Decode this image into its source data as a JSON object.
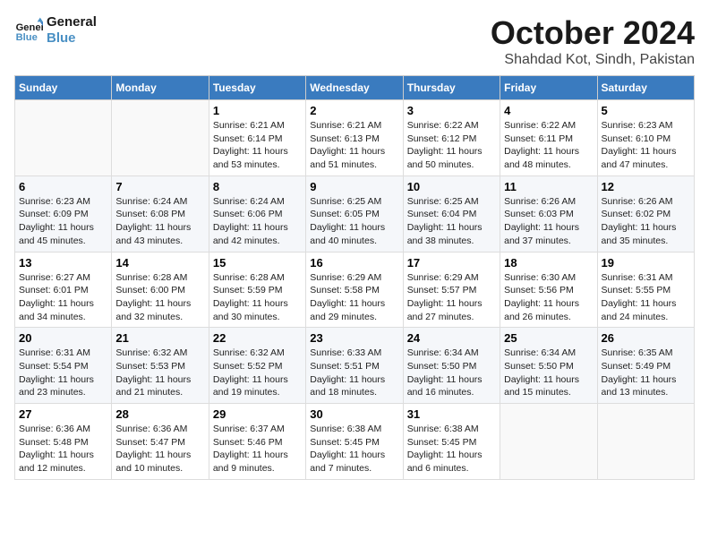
{
  "header": {
    "logo_line1": "General",
    "logo_line2": "Blue",
    "month": "October 2024",
    "location": "Shahdad Kot, Sindh, Pakistan"
  },
  "weekdays": [
    "Sunday",
    "Monday",
    "Tuesday",
    "Wednesday",
    "Thursday",
    "Friday",
    "Saturday"
  ],
  "weeks": [
    [
      {
        "day": "",
        "info": ""
      },
      {
        "day": "",
        "info": ""
      },
      {
        "day": "1",
        "info": "Sunrise: 6:21 AM\nSunset: 6:14 PM\nDaylight: 11 hours and 53 minutes."
      },
      {
        "day": "2",
        "info": "Sunrise: 6:21 AM\nSunset: 6:13 PM\nDaylight: 11 hours and 51 minutes."
      },
      {
        "day": "3",
        "info": "Sunrise: 6:22 AM\nSunset: 6:12 PM\nDaylight: 11 hours and 50 minutes."
      },
      {
        "day": "4",
        "info": "Sunrise: 6:22 AM\nSunset: 6:11 PM\nDaylight: 11 hours and 48 minutes."
      },
      {
        "day": "5",
        "info": "Sunrise: 6:23 AM\nSunset: 6:10 PM\nDaylight: 11 hours and 47 minutes."
      }
    ],
    [
      {
        "day": "6",
        "info": "Sunrise: 6:23 AM\nSunset: 6:09 PM\nDaylight: 11 hours and 45 minutes."
      },
      {
        "day": "7",
        "info": "Sunrise: 6:24 AM\nSunset: 6:08 PM\nDaylight: 11 hours and 43 minutes."
      },
      {
        "day": "8",
        "info": "Sunrise: 6:24 AM\nSunset: 6:06 PM\nDaylight: 11 hours and 42 minutes."
      },
      {
        "day": "9",
        "info": "Sunrise: 6:25 AM\nSunset: 6:05 PM\nDaylight: 11 hours and 40 minutes."
      },
      {
        "day": "10",
        "info": "Sunrise: 6:25 AM\nSunset: 6:04 PM\nDaylight: 11 hours and 38 minutes."
      },
      {
        "day": "11",
        "info": "Sunrise: 6:26 AM\nSunset: 6:03 PM\nDaylight: 11 hours and 37 minutes."
      },
      {
        "day": "12",
        "info": "Sunrise: 6:26 AM\nSunset: 6:02 PM\nDaylight: 11 hours and 35 minutes."
      }
    ],
    [
      {
        "day": "13",
        "info": "Sunrise: 6:27 AM\nSunset: 6:01 PM\nDaylight: 11 hours and 34 minutes."
      },
      {
        "day": "14",
        "info": "Sunrise: 6:28 AM\nSunset: 6:00 PM\nDaylight: 11 hours and 32 minutes."
      },
      {
        "day": "15",
        "info": "Sunrise: 6:28 AM\nSunset: 5:59 PM\nDaylight: 11 hours and 30 minutes."
      },
      {
        "day": "16",
        "info": "Sunrise: 6:29 AM\nSunset: 5:58 PM\nDaylight: 11 hours and 29 minutes."
      },
      {
        "day": "17",
        "info": "Sunrise: 6:29 AM\nSunset: 5:57 PM\nDaylight: 11 hours and 27 minutes."
      },
      {
        "day": "18",
        "info": "Sunrise: 6:30 AM\nSunset: 5:56 PM\nDaylight: 11 hours and 26 minutes."
      },
      {
        "day": "19",
        "info": "Sunrise: 6:31 AM\nSunset: 5:55 PM\nDaylight: 11 hours and 24 minutes."
      }
    ],
    [
      {
        "day": "20",
        "info": "Sunrise: 6:31 AM\nSunset: 5:54 PM\nDaylight: 11 hours and 23 minutes."
      },
      {
        "day": "21",
        "info": "Sunrise: 6:32 AM\nSunset: 5:53 PM\nDaylight: 11 hours and 21 minutes."
      },
      {
        "day": "22",
        "info": "Sunrise: 6:32 AM\nSunset: 5:52 PM\nDaylight: 11 hours and 19 minutes."
      },
      {
        "day": "23",
        "info": "Sunrise: 6:33 AM\nSunset: 5:51 PM\nDaylight: 11 hours and 18 minutes."
      },
      {
        "day": "24",
        "info": "Sunrise: 6:34 AM\nSunset: 5:50 PM\nDaylight: 11 hours and 16 minutes."
      },
      {
        "day": "25",
        "info": "Sunrise: 6:34 AM\nSunset: 5:50 PM\nDaylight: 11 hours and 15 minutes."
      },
      {
        "day": "26",
        "info": "Sunrise: 6:35 AM\nSunset: 5:49 PM\nDaylight: 11 hours and 13 minutes."
      }
    ],
    [
      {
        "day": "27",
        "info": "Sunrise: 6:36 AM\nSunset: 5:48 PM\nDaylight: 11 hours and 12 minutes."
      },
      {
        "day": "28",
        "info": "Sunrise: 6:36 AM\nSunset: 5:47 PM\nDaylight: 11 hours and 10 minutes."
      },
      {
        "day": "29",
        "info": "Sunrise: 6:37 AM\nSunset: 5:46 PM\nDaylight: 11 hours and 9 minutes."
      },
      {
        "day": "30",
        "info": "Sunrise: 6:38 AM\nSunset: 5:45 PM\nDaylight: 11 hours and 7 minutes."
      },
      {
        "day": "31",
        "info": "Sunrise: 6:38 AM\nSunset: 5:45 PM\nDaylight: 11 hours and 6 minutes."
      },
      {
        "day": "",
        "info": ""
      },
      {
        "day": "",
        "info": ""
      }
    ]
  ]
}
